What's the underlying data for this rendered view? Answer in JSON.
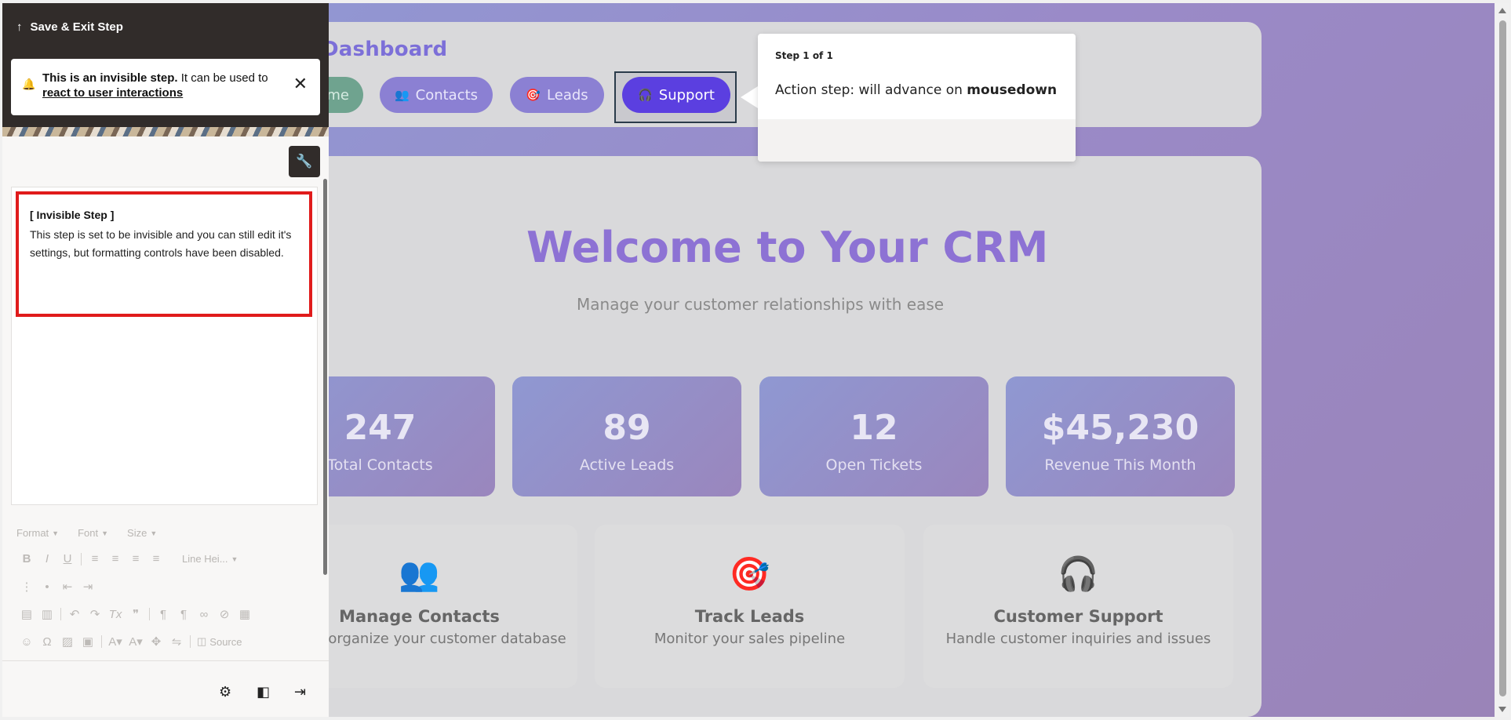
{
  "crm": {
    "header_title": "Dashboard",
    "nav": {
      "home_label": "me",
      "contacts_label": "Contacts",
      "leads_label": "Leads",
      "support_label": "Support"
    },
    "welcome_title": "Welcome to Your CRM",
    "welcome_subtitle": "Manage your customer relationships with ease",
    "stats": [
      {
        "value": "247",
        "label": "Total Contacts"
      },
      {
        "value": "89",
        "label": "Active Leads"
      },
      {
        "value": "12",
        "label": "Open Tickets"
      },
      {
        "value": "$45,230",
        "label": "Revenue This Month"
      }
    ],
    "features": [
      {
        "icon": "people-icon",
        "title": "Manage Contacts",
        "desc": "ew and organize your customer database"
      },
      {
        "icon": "target-icon",
        "title": "Track Leads",
        "desc": "Monitor your sales pipeline"
      },
      {
        "icon": "headphones-icon",
        "title": "Customer Support",
        "desc": "Handle customer inquiries and issues"
      }
    ]
  },
  "tooltip": {
    "step_text": "Step 1 of 1",
    "message_prefix": "Action step: will advance on ",
    "message_event": "mousedown"
  },
  "panel": {
    "save_exit_label": "Save & Exit Step",
    "notice_bold": "This is an invisible step.",
    "notice_rest": " It can be used to ",
    "notice_link": "react to user interactions",
    "invisible_title": "[ Invisible Step ]",
    "invisible_body": "This step is set to be invisible and you can still edit it's settings, but formatting controls have been disabled.",
    "toolbar": {
      "format_label": "Format",
      "font_label": "Font",
      "size_label": "Size",
      "line_height_label": "Line Hei...",
      "source_label": "Source"
    }
  },
  "colors": {
    "accent": "#5b3fe0",
    "title_purple": "#8d72d4",
    "panel_dark": "#312c2a",
    "highlight_red": "#e01b1b"
  }
}
